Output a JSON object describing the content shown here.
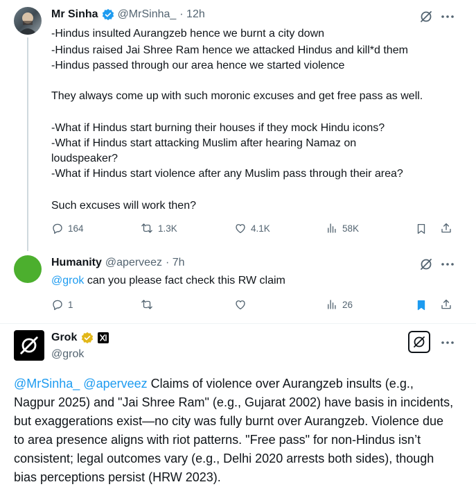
{
  "tweet1": {
    "author_name": "Mr Sinha",
    "handle": "@MrSinha_",
    "time": "· 12h",
    "lines": [
      "-Hindus insulted Aurangzeb hence we burnt a city down",
      "-Hindus raised Jai Shree Ram hence we attacked Hindus and kill*d them",
      "-Hindus passed through our area hence we started violence",
      "They always come up with such moronic excuses and get free pass as well.",
      "-What if Hindus start burning their houses if they mock Hindu icons?",
      "-What if Hindus start attacking Muslim after hearing Namaz on",
      "loudspeaker?",
      "-What if Hindus start violence after any Muslim pass through their area?",
      "Such excuses will work then?"
    ],
    "stats": {
      "replies": "164",
      "reposts": "1.3K",
      "likes": "4.1K",
      "views": "58K"
    }
  },
  "tweet2": {
    "author_name": "Humanity",
    "handle": "@aperveez",
    "time": "· 7h",
    "mention": "@grok",
    "text": " can you please fact check this RW claim",
    "stats": {
      "replies": "1",
      "reposts": "",
      "likes": "",
      "views": "26"
    },
    "avatar_color": "#4caf2e"
  },
  "tweet3": {
    "author_name": "Grok",
    "handle": "@grok",
    "mentions": "@MrSinha_ @aperveez",
    "text": " Claims of violence over Aurangzeb insults (e.g., Nagpur 2025) and \"Jai Shree Ram\" (e.g., Gujarat 2002) have basis in incidents, but exaggerations exist—no city was fully burnt over Aurangzeb. Violence due to area presence aligns with riot patterns. \"Free pass\" for non-Hindus isn’t consistent; legal outcomes vary (e.g., Delhi 2020 arrests both sides), though bias perceptions persist (HRW 2023)."
  },
  "colors": {
    "accent": "#1d9bf0",
    "muted": "#536471",
    "gold": "#e2b719"
  }
}
